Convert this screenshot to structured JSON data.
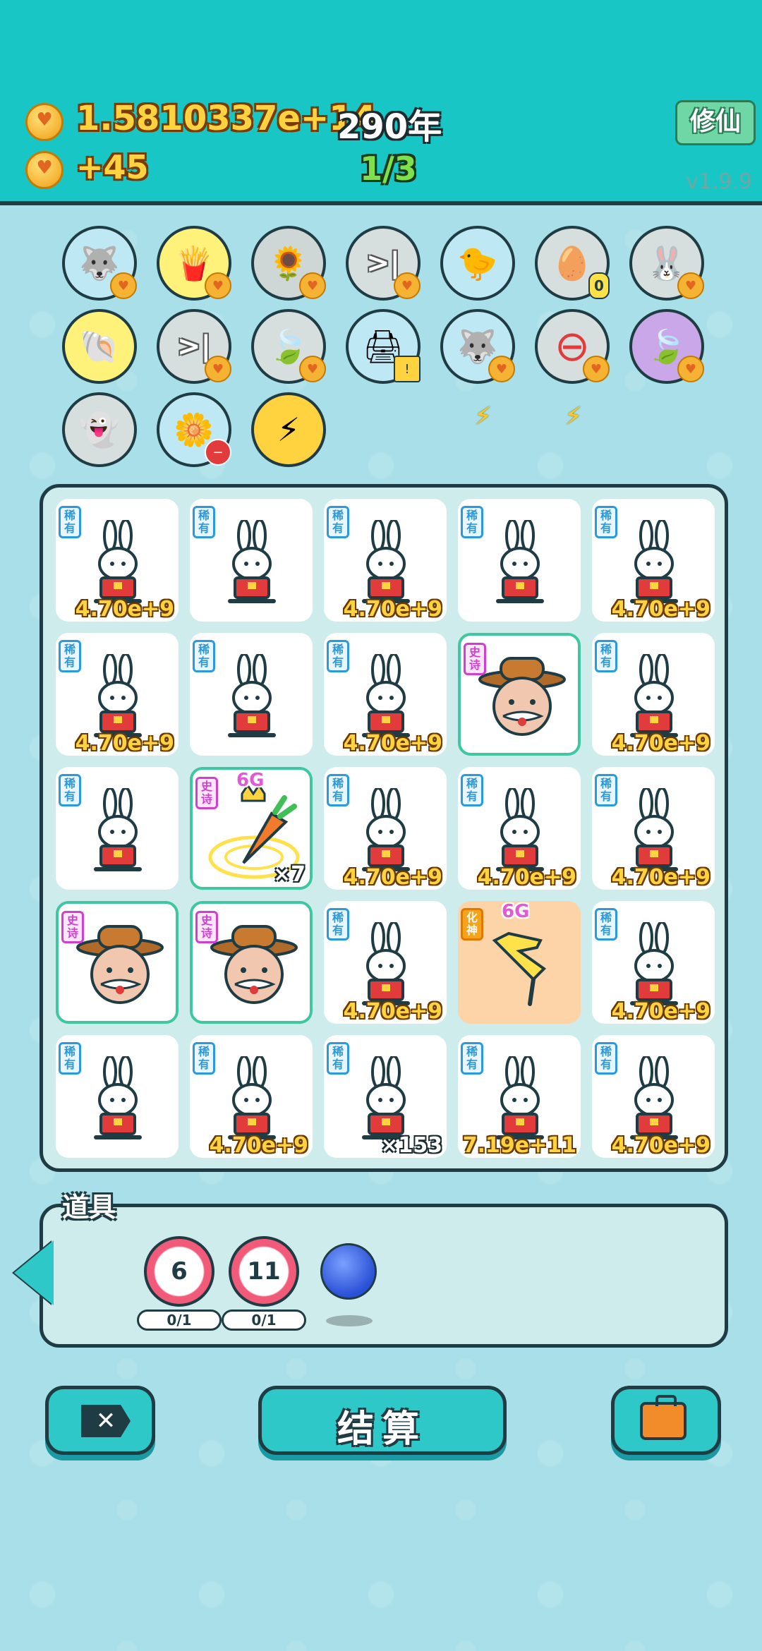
{
  "hud": {
    "coins": "1.5810337e+14",
    "years": "290年",
    "income": "+45",
    "progress": "1/3",
    "xiuxian_label": "修仙",
    "version": "v1.9.9"
  },
  "relics": [
    {
      "icon": "husky-icon",
      "bg": "#bfe8f5",
      "emoji": "🐺",
      "badge": "coin"
    },
    {
      "icon": "fries-icon",
      "bg": "#fff27a",
      "emoji": "🍟",
      "badge": "coin"
    },
    {
      "icon": "sunflower-icon",
      "bg": "#cfd6d6",
      "emoji": "🌻",
      "badge": "coin"
    },
    {
      "icon": "skip-icon",
      "bg": "#d6dede",
      "emoji": ">|",
      "badge": "coin"
    },
    {
      "icon": "chick-egg-icon",
      "bg": "#bfe8f5",
      "emoji": "🐤",
      "badge": ""
    },
    {
      "icon": "egg-carton-icon",
      "bg": "#d6dede",
      "emoji": "🥚",
      "badge": "count",
      "count": "0"
    },
    {
      "icon": "bunny-icon",
      "bg": "#d6dede",
      "emoji": "🐰",
      "badge": "coin"
    },
    {
      "icon": "shell-icon",
      "bg": "#fff27a",
      "emoji": "🐚",
      "badge": ""
    },
    {
      "icon": "skip-icon",
      "bg": "#d6dede",
      "emoji": ">|",
      "badge": "coin"
    },
    {
      "icon": "leaf-icon",
      "bg": "#d6dede",
      "emoji": "🍃",
      "badge": "coin"
    },
    {
      "icon": "printer-icon",
      "bg": "#bfe8f5",
      "emoji": "🖨",
      "badge": "warn"
    },
    {
      "icon": "husky-icon",
      "bg": "#bfe8f5",
      "emoji": "🐺",
      "badge": "coin"
    },
    {
      "icon": "minus-circle-icon",
      "bg": "#d6dede",
      "emoji": "⊖",
      "badge": "coin"
    },
    {
      "icon": "leaf-icon",
      "bg": "#c9a7e8",
      "emoji": "🍃",
      "badge": "coin"
    },
    {
      "icon": "ghost-icon",
      "bg": "#d6dede",
      "emoji": "👻",
      "badge": ""
    },
    {
      "icon": "flower-pot-icon",
      "bg": "#bfe8f5",
      "emoji": "🌼",
      "badge": "red"
    },
    {
      "icon": "lightning-icon",
      "bg": "#ffd23f",
      "emoji": "⚡",
      "badge": ""
    }
  ],
  "grid": [
    [
      {
        "kind": "bunny",
        "tag": "稀有",
        "value": "4.70e+9"
      },
      {
        "kind": "bunny",
        "tag": "稀有",
        "value": ""
      },
      {
        "kind": "bunny",
        "tag": "稀有",
        "value": "4.70e+9"
      },
      {
        "kind": "bunny",
        "tag": "稀有",
        "value": ""
      },
      {
        "kind": "bunny",
        "tag": "稀有",
        "value": "4.70e+9"
      }
    ],
    [
      {
        "kind": "bunny",
        "tag": "稀有",
        "value": "4.70e+9"
      },
      {
        "kind": "bunny",
        "tag": "稀有",
        "value": ""
      },
      {
        "kind": "bunny",
        "tag": "稀有",
        "value": "4.70e+9"
      },
      {
        "kind": "farmer",
        "tag": "史诗",
        "value": ""
      },
      {
        "kind": "bunny",
        "tag": "稀有",
        "value": "4.70e+9"
      }
    ],
    [
      {
        "kind": "bunny",
        "tag": "稀有",
        "value": ""
      },
      {
        "kind": "carrot",
        "tag": "史诗",
        "value": "×7",
        "top": "6G"
      },
      {
        "kind": "bunny",
        "tag": "稀有",
        "value": "4.70e+9"
      },
      {
        "kind": "bunny",
        "tag": "稀有",
        "value": "4.70e+9"
      },
      {
        "kind": "bunny",
        "tag": "稀有",
        "value": "4.70e+9"
      }
    ],
    [
      {
        "kind": "farmer",
        "tag": "史诗",
        "value": ""
      },
      {
        "kind": "farmer",
        "tag": "史诗",
        "value": ""
      },
      {
        "kind": "bunny",
        "tag": "稀有",
        "value": "4.70e+9"
      },
      {
        "kind": "hand",
        "tag": "化神",
        "value": "",
        "top": "6G"
      },
      {
        "kind": "bunny",
        "tag": "稀有",
        "value": "4.70e+9"
      }
    ],
    [
      {
        "kind": "bunny",
        "tag": "稀有",
        "value": ""
      },
      {
        "kind": "bunny",
        "tag": "稀有",
        "value": "4.70e+9"
      },
      {
        "kind": "bunny",
        "tag": "稀有",
        "value": "×153"
      },
      {
        "kind": "bunny",
        "tag": "稀有",
        "value": "7.19e+11"
      },
      {
        "kind": "bunny",
        "tag": "稀有",
        "value": "4.70e+9"
      }
    ]
  ],
  "items": {
    "title": "道具",
    "list": [
      {
        "label": "6",
        "count": "0/1"
      },
      {
        "label": "11",
        "count": "0/1"
      }
    ]
  },
  "buttons": {
    "settle": "结算"
  },
  "colors": {
    "header": "#18c6c6",
    "accent": "#2fc8c8",
    "outline": "#1f3c44",
    "gold": "#ffd23f"
  }
}
